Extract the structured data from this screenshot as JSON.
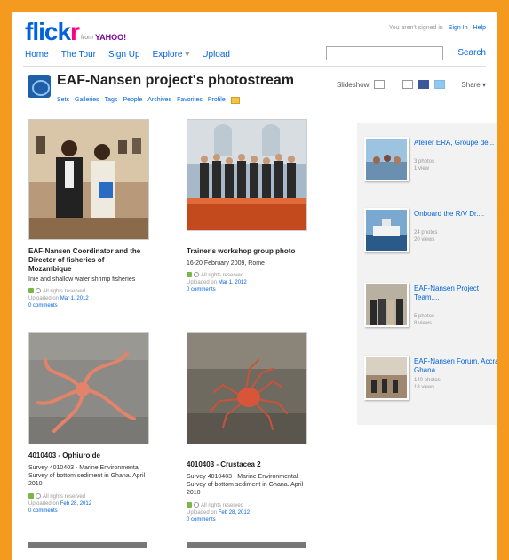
{
  "header": {
    "logo_main": "flick",
    "logo_r": "r",
    "logo_from": "from",
    "logo_yahoo": "YAHOO!",
    "nav": [
      "Home",
      "The Tour",
      "Sign Up",
      "Explore",
      "Upload"
    ],
    "nav_explore_caret": "▾",
    "signed_in_text": "You aren't signed in",
    "sign_in": "Sign In",
    "help": "Help",
    "search_button": "Search",
    "search_placeholder": ""
  },
  "profile": {
    "title": "EAF-Nansen project's photostream",
    "subnav": [
      "Sets",
      "Galleries",
      "Tags",
      "People",
      "Archives",
      "Favorites",
      "Profile"
    ],
    "slideshow": "Slideshow",
    "share": "Share ▾"
  },
  "photos": [
    {
      "title_lines": [
        "EAF-Nansen Coordinator and the",
        "Director of fisheries of",
        "Mozambique"
      ],
      "desc_lines": [
        "Inie and shallow water shrimp fisheries"
      ],
      "rights": "All rights reserved",
      "uploaded": "Uploaded on",
      "date": "Mar 1, 2012",
      "comments": "0 comments"
    },
    {
      "title_lines": [
        "Trainer's workshop group photo"
      ],
      "desc_lines": [
        "16-20 February 2009, Rome"
      ],
      "rights": "All rights reserved",
      "uploaded": "Uploaded on",
      "date": "Mar 1, 2012",
      "comments": "0 comments"
    },
    {
      "title_lines": [
        "4010403 - Ophiuroide"
      ],
      "desc_lines": [
        "Survey 4010403 - Marine Environmental",
        "Survey of bottom sediment in Ghana. April",
        "2010"
      ],
      "rights": "All rights reserved",
      "uploaded": "Uploaded on",
      "date": "Feb 28, 2012",
      "comments": "0 comments"
    },
    {
      "title_lines": [
        "4010403 - Crustacea 2"
      ],
      "desc_lines": [
        "Survey 4010403 - Marine Environmental",
        "Survey of bottom sediment in Ghana. April",
        "2010"
      ],
      "rights": "All rights reserved",
      "uploaded": "Uploaded on",
      "date": "Feb 28, 2012",
      "comments": "0 comments"
    }
  ],
  "sets": [
    {
      "name": "Atelier ERA, Groupe de...",
      "photos": "3 photos",
      "views": "1 view"
    },
    {
      "name": "Onboard the R/V Dr....",
      "photos": "24 photos",
      "views": "20 views"
    },
    {
      "name": "EAF-Nansen Project Team....",
      "photos": "5 photos",
      "views": "8 views"
    },
    {
      "name": "EAF-Nansen Forum, Accra Ghana",
      "photos": "140 photos",
      "views": "18 views"
    }
  ]
}
